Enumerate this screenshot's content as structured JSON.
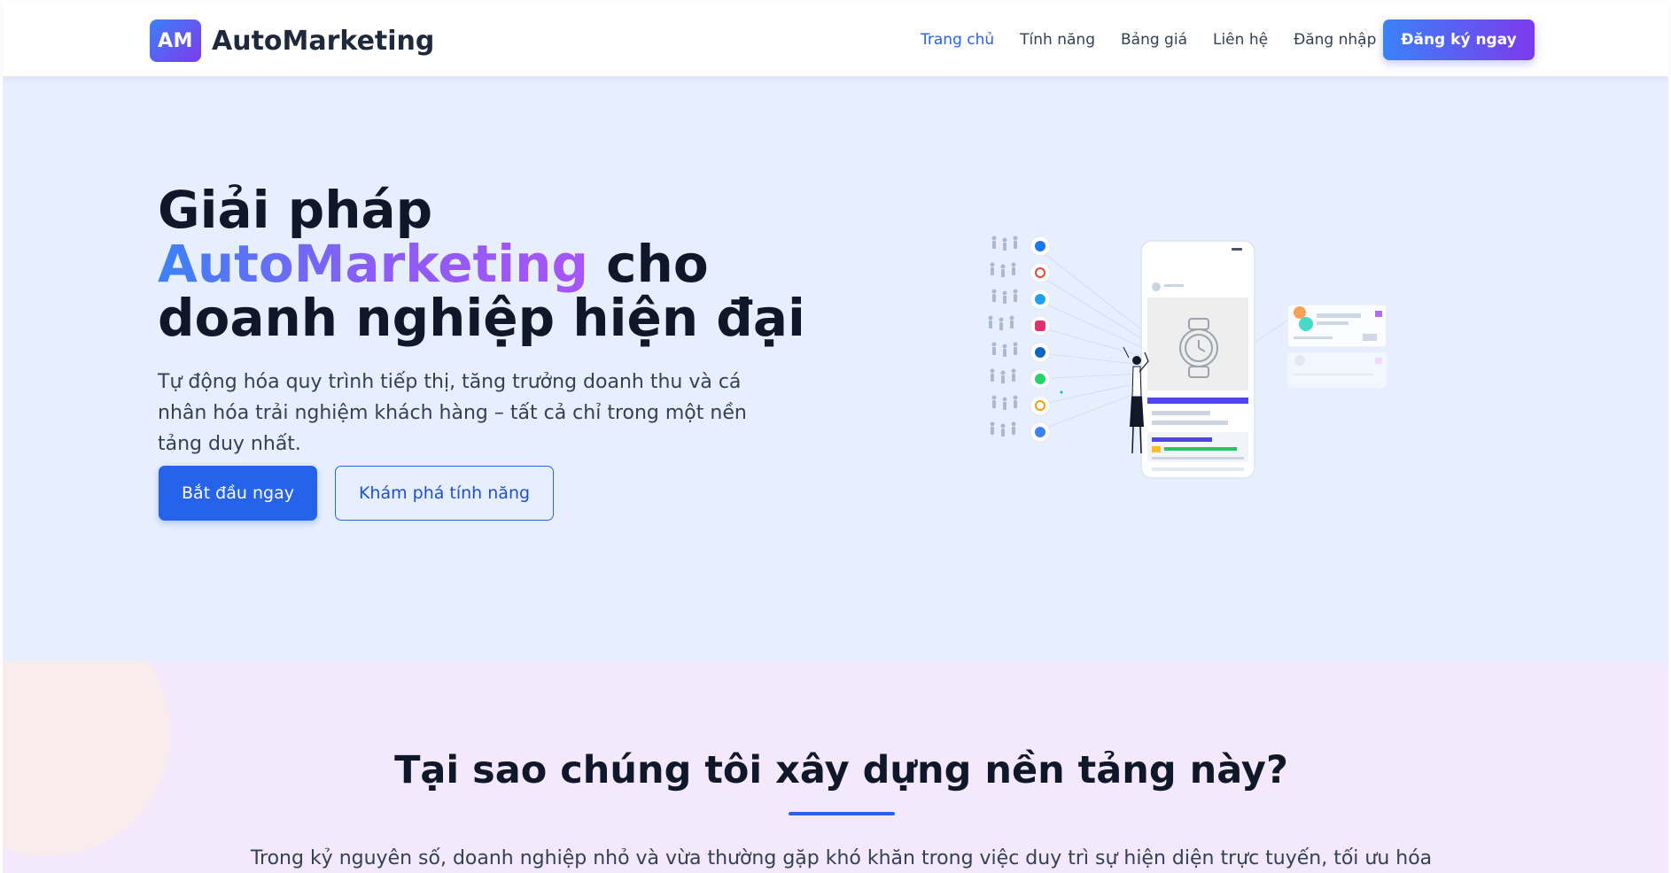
{
  "header": {
    "logo_mark": "AM",
    "brand": "AutoMarketing",
    "nav": [
      {
        "label": "Trang chủ",
        "active": true
      },
      {
        "label": "Tính năng",
        "active": false
      },
      {
        "label": "Bảng giá",
        "active": false
      },
      {
        "label": "Liên hệ",
        "active": false
      },
      {
        "label": "Đăng nhập",
        "active": false
      }
    ],
    "cta": "Đăng ký ngay"
  },
  "hero": {
    "title_line1": "Giải pháp",
    "title_highlight": "AutoMarketing",
    "title_line2_rest": " cho",
    "title_line3": "doanh nghiệp hiện đại",
    "subtitle": "Tự động hóa quy trình tiếp thị, tăng trưởng doanh thu và cá nhân hóa trải nghiệm khách hàng – tất cả chỉ trong một nền tảng duy nhất.",
    "primary_button": "Bắt đầu ngay",
    "secondary_button": "Khám phá tính năng",
    "illustration": {
      "channels": [
        "facebook-icon",
        "google-icon",
        "twitter-icon",
        "instagram-icon",
        "linkedin-icon",
        "whatsapp-icon",
        "email-icon",
        "messenger-icon"
      ]
    }
  },
  "why": {
    "title": "Tại sao chúng tôi xây dựng nền tảng này?",
    "text": "Trong kỷ nguyên số, doanh nghiệp nhỏ và vừa thường gặp khó khăn trong việc duy trì sự hiện diện trực tuyến, tối ưu hóa"
  },
  "colors": {
    "primary": "#2563eb",
    "gradient_start": "#3b82f6",
    "gradient_end": "#7c3aed",
    "hero_bg": "#e7efff",
    "section_bg": "#f4e8fd"
  }
}
